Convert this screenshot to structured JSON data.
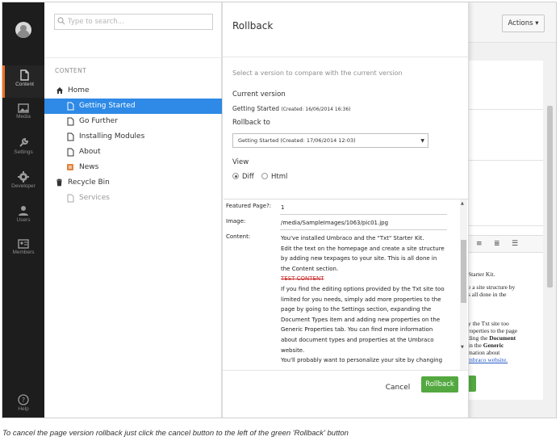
{
  "nav": {
    "items": [
      {
        "label": "Content",
        "icon": "document-icon"
      },
      {
        "label": "Media",
        "icon": "image-icon"
      },
      {
        "label": "Settings",
        "icon": "wrench-icon"
      },
      {
        "label": "Developer",
        "icon": "gear-icon"
      },
      {
        "label": "Users",
        "icon": "user-icon"
      },
      {
        "label": "Members",
        "icon": "id-card-icon"
      }
    ],
    "help_label": "Help",
    "active": "Content",
    "active_color": "#f36f21"
  },
  "tree": {
    "search_placeholder": "Type to search...",
    "section_title": "CONTENT",
    "nodes": [
      {
        "label": "Home",
        "icon": "home-icon"
      },
      {
        "label": "Getting Started",
        "icon": "document-icon",
        "selected": true
      },
      {
        "label": "Go Further",
        "icon": "document-icon"
      },
      {
        "label": "Installing Modules",
        "icon": "document-icon"
      },
      {
        "label": "About",
        "icon": "document-icon"
      },
      {
        "label": "News",
        "icon": "newspaper-icon"
      },
      {
        "label": "Recycle Bin",
        "icon": "trash-icon"
      },
      {
        "label": "Services",
        "icon": "document-icon",
        "muted": true
      }
    ],
    "selected_color": "#2e8ae6"
  },
  "header": {
    "actions_label": "Actions ▾"
  },
  "modal": {
    "title": "Rollback",
    "lead": "Select a version to compare with the current version",
    "current_version_label": "Current version",
    "current_version_name": "Getting Started",
    "current_version_created": "(Created: 16/06/2014 16:36)",
    "rollback_to_label": "Rollback to",
    "rollback_to_value": "Getting Started (Created: 17/06/2014 12:03)",
    "view_label": "View",
    "view_options": [
      "Diff",
      "Html"
    ],
    "view_selected": "Diff",
    "diff": {
      "featured_key": "Featured Page?:",
      "featured_value": "1",
      "image_key": "Image:",
      "image_value": "/media/SampleImages/1063/pic01.jpg",
      "content_key": "Content:",
      "content_p1": "You've installed Umbraco and the \"Txt\" Starter Kit.",
      "content_p2": "Edit the text on the homepage and create a site structure by adding new texpages to your site. This is all done in the Content section.",
      "content_deleted": "TEST CONTENT",
      "content_p3": "If you find the editing options provided by the Txt site too limited for you needs, simply add more properties to the page by going to the Settings section, expanding the Document Types item and adding new properties on the Generic Properties tab. You can find more information about document types and properties at the Umbraco website.",
      "content_p4": "You'll probably want to personalize your site by changing"
    },
    "cancel_label": "Cancel",
    "rollback_label": "Rollback",
    "rollback_color": "#53a93f"
  },
  "background_editor": {
    "line1": "Starter Kit.",
    "line2": "e a site structure by",
    "line3": "s all done in the",
    "line4": "y the Txt site too",
    "line5": "roperties to the page",
    "line6_pre": "ding the ",
    "line6_bold": "Document",
    "line7_pre": "in the ",
    "line7_bold": "Generic",
    "line8": "mation about",
    "line9": "mbraco website."
  },
  "caption": "To cancel the page version rollback just click the cancel button to the left of the green 'Rollback' button"
}
